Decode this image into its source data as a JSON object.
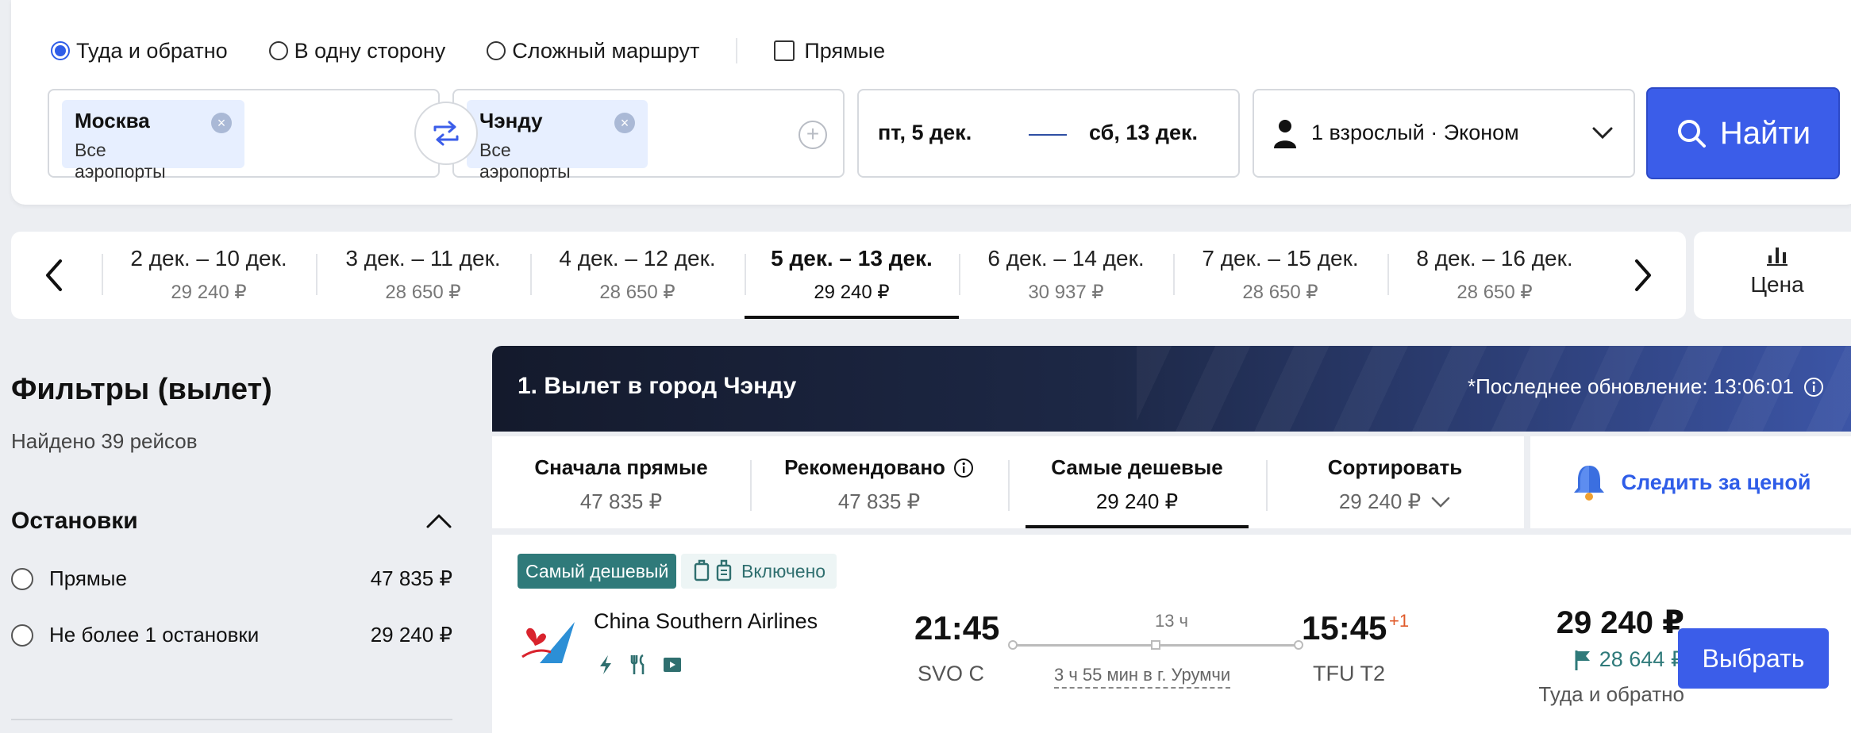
{
  "search": {
    "trip_types": [
      {
        "label": "Туда и обратно",
        "checked": true
      },
      {
        "label": "В одну сторону",
        "checked": false
      },
      {
        "label": "Сложный маршрут",
        "checked": false
      }
    ],
    "direct_label": "Прямые",
    "from": {
      "city": "Москва",
      "airports": "Все аэропорты"
    },
    "to": {
      "city": "Чэнду",
      "airports": "Все аэропорты"
    },
    "dates": {
      "start": "пт, 5 дек.",
      "end": "сб, 13 дек."
    },
    "passengers": "1 взрослый · Эконом",
    "find_label": "Найти"
  },
  "date_strip": {
    "active_index": 3,
    "items": [
      {
        "range": "2 дек. – 10 дек.",
        "price": "29 240 ₽"
      },
      {
        "range": "3 дек. – 11 дек.",
        "price": "28 650 ₽"
      },
      {
        "range": "4 дек. – 12 дек.",
        "price": "28 650 ₽"
      },
      {
        "range": "5 дек. – 13 дек.",
        "price": "29 240 ₽"
      },
      {
        "range": "6 дек. – 14 дек.",
        "price": "30 937 ₽"
      },
      {
        "range": "7 дек. – 15 дек.",
        "price": "28 650 ₽"
      },
      {
        "range": "8 дек. – 16 дек.",
        "price": "28 650 ₽"
      }
    ],
    "price_toggle_label": "Цена"
  },
  "filters": {
    "title": "Фильтры (вылет)",
    "found": "Найдено 39 рейсов",
    "stops_title": "Остановки",
    "stops": [
      {
        "label": "Прямые",
        "price": "47 835 ₽"
      },
      {
        "label": "Не более 1 остановки",
        "price": "29 240 ₽"
      }
    ]
  },
  "results": {
    "banner_title": "1. Вылет в город Чэнду",
    "last_update": "*Последнее обновление: 13:06:01",
    "sort_tabs": [
      {
        "title": "Сначала прямые",
        "price": "47 835 ₽"
      },
      {
        "title": "Рекомендовано",
        "price": "47 835 ₽"
      },
      {
        "title": "Самые дешевые",
        "price": "29 240 ₽"
      },
      {
        "title": "Сортировать",
        "price": "29 240 ₽"
      }
    ],
    "watch_price_label": "Следить за ценой",
    "flight": {
      "badge_cheapest": "Самый дешевый",
      "badge_included": "Включено",
      "airline": "China Southern Airlines",
      "dep_time": "21:45",
      "dep_code": "SVO C",
      "duration": "13 ч",
      "layover": "3 ч 55 мин в г. Урумчи",
      "arr_time": "15:45",
      "arr_plus": "+1",
      "arr_code": "TFU T2",
      "price": "29 240 ₽",
      "alt_price": "28 644 ₽",
      "price_note": "Туда и обратно",
      "select_label": "Выбрать"
    }
  },
  "colors": {
    "accent": "#3b5de9",
    "teal": "#2f7a7a",
    "banner_dark": "#141a2c"
  }
}
